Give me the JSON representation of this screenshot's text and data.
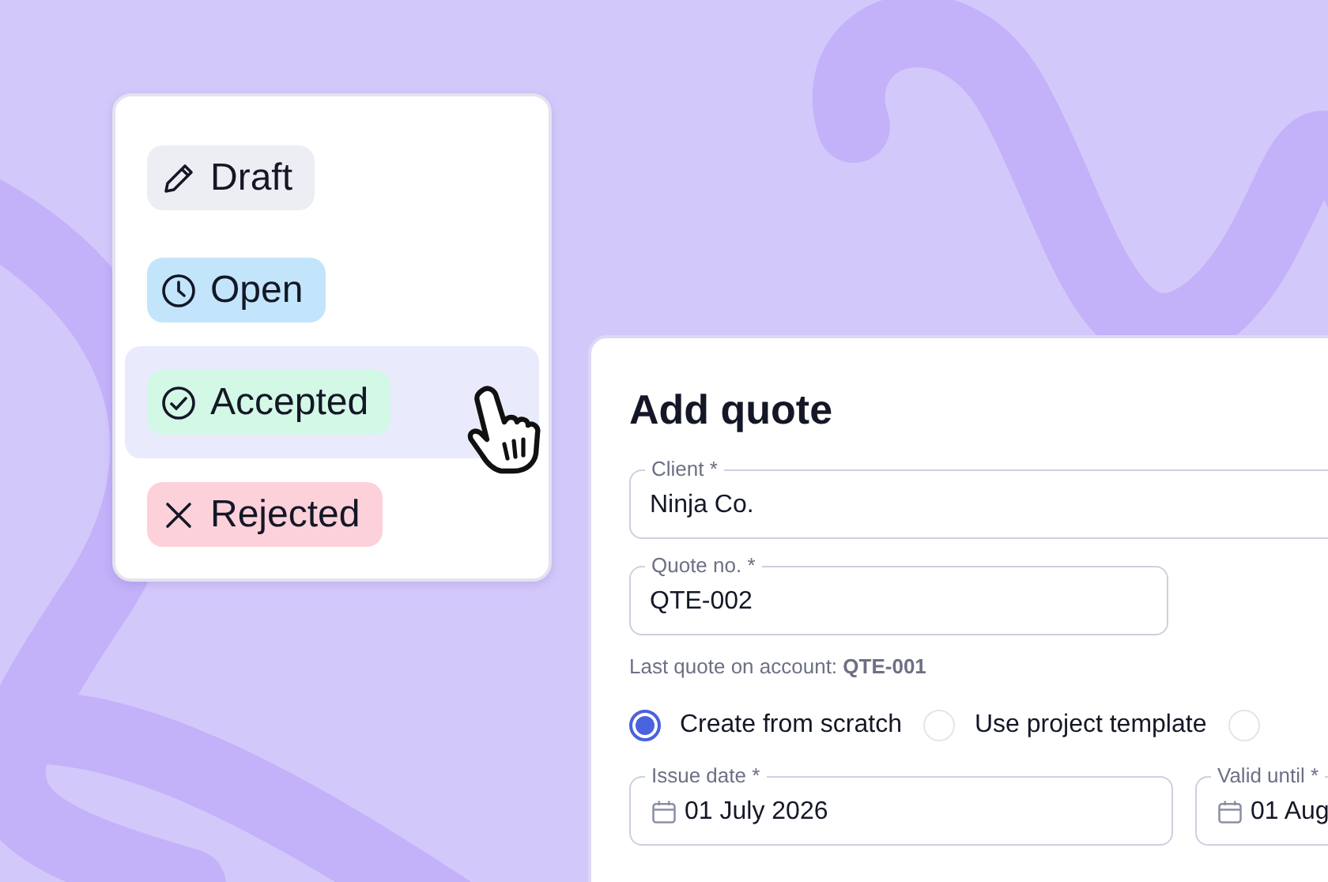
{
  "status_menu": {
    "items": [
      {
        "label": "Draft",
        "kind": "pencil",
        "color": "#eceef3",
        "selected": false
      },
      {
        "label": "Open",
        "kind": "clock",
        "color": "#c2e5fc",
        "selected": false
      },
      {
        "label": "Accepted",
        "kind": "check",
        "color": "#d3f8e6",
        "selected": true
      },
      {
        "label": "Rejected",
        "kind": "cross",
        "color": "#fdd1da",
        "selected": false
      }
    ]
  },
  "form": {
    "title": "Add quote",
    "client": {
      "label": "Client *",
      "value": "Ninja Co."
    },
    "quote_no": {
      "label": "Quote no. *",
      "value": "QTE-002"
    },
    "hint": "Last quote on account: **QTE-001**",
    "options": [
      {
        "label": "Create from scratch",
        "selected": true
      },
      {
        "label": "Use project template",
        "selected": false
      },
      {
        "selected": false
      }
    ],
    "issue_date": {
      "label": "Issue date *",
      "value": "01 July 2026"
    },
    "valid_until": {
      "label": "Valid until *",
      "value": "01 Aug"
    }
  }
}
